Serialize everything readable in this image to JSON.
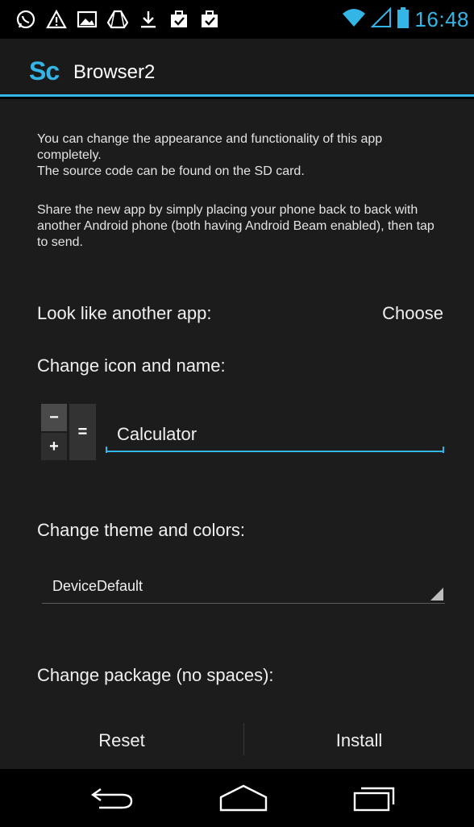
{
  "status_bar": {
    "time": "16:48",
    "icons": [
      "whatsapp-icon",
      "warning-icon",
      "image-icon",
      "drive-icon",
      "download-icon",
      "briefcase-check-icon",
      "briefcase-check-icon"
    ],
    "accent_color": "#33b5e5"
  },
  "action_bar": {
    "logo": "Sc",
    "title": "Browser2"
  },
  "content": {
    "intro_line1": "You can change the appearance and functionality of this app completely.",
    "intro_line2": "The source code can be found on the SD card.",
    "share_text": "Share the new app by simply placing your phone back to back with another Android phone (both having Android Beam enabled), then tap to send.",
    "look_label": "Look like another app:",
    "choose_label": "Choose",
    "icon_name_label": "Change icon and name:",
    "name_value": "Calculator",
    "theme_label": "Change theme and colors:",
    "theme_value": "DeviceDefault",
    "package_label": "Change package (no spaces):"
  },
  "calc_icon": {
    "minus": "−",
    "plus": "+",
    "equals": "="
  },
  "buttons": {
    "reset": "Reset",
    "install": "Install"
  },
  "nav_bar": {
    "icons": [
      "back-icon",
      "home-icon",
      "recent-apps-icon"
    ]
  }
}
